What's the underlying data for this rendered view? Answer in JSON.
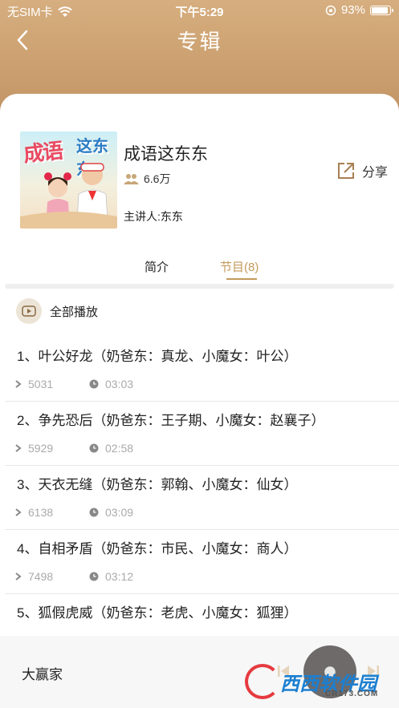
{
  "status_bar": {
    "carrier": "无SIM卡",
    "time": "下午5:29",
    "battery": "93%"
  },
  "header": {
    "title": "专辑"
  },
  "album": {
    "cover_title_main": "成语",
    "cover_title_side": "这东东",
    "title": "成语这东东",
    "listens": "6.6万",
    "host": "主讲人:东东",
    "share_label": "分享"
  },
  "tabs": {
    "intro": "简介",
    "programs": "节目(8)"
  },
  "play_all_label": "全部播放",
  "episodes": [
    {
      "title": "1、叶公好龙（奶爸东：真龙、小魔女：叶公）",
      "plays": "5031",
      "duration": "03:03"
    },
    {
      "title": "2、争先恐后（奶爸东：王子期、小魔女：赵襄子）",
      "plays": "5929",
      "duration": "02:58"
    },
    {
      "title": "3、天衣无缝（奶爸东：郭翰、小魔女：仙女）",
      "plays": "6138",
      "duration": "03:09"
    },
    {
      "title": "4、自相矛盾（奶爸东：市民、小魔女：商人）",
      "plays": "7498",
      "duration": "03:12"
    },
    {
      "title": "5、狐假虎威（奶爸东：老虎、小魔女：狐狸）"
    }
  ],
  "player": {
    "now_playing": "大赢家"
  },
  "watermark": {
    "brand": "西西软件园",
    "domain": "CR173.COM"
  },
  "colors": {
    "accent": "#c49a5c",
    "header_gradient_top": "#d6ae7f",
    "header_gradient_bottom": "#b38657"
  }
}
